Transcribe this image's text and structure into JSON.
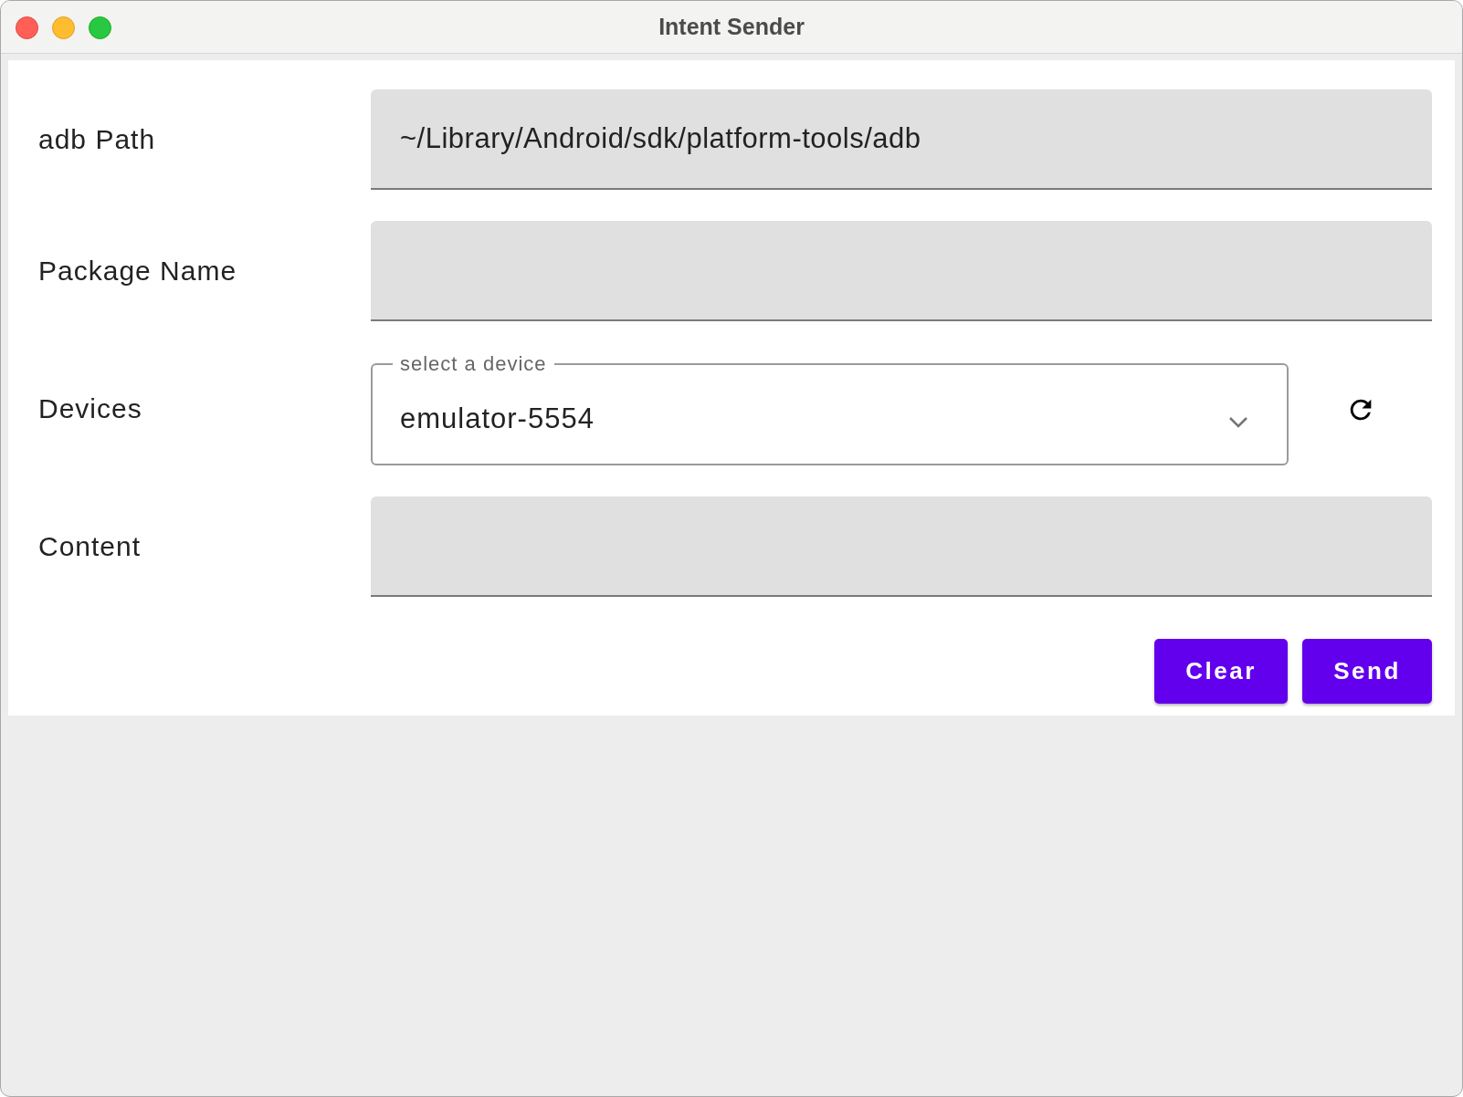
{
  "window": {
    "title": "Intent Sender"
  },
  "fields": [
    {
      "kind": "text",
      "label": "adb Path",
      "value": "~/Library/Android/sdk/platform-tools/adb"
    },
    {
      "kind": "text",
      "label": "Package Name"
    },
    {
      "kind": "select",
      "label": "Devices",
      "floating_label": "select a device",
      "value": "emulator-5554"
    },
    {
      "kind": "text",
      "label": "Content"
    }
  ],
  "buttons": [
    "Clear",
    "Send"
  ]
}
